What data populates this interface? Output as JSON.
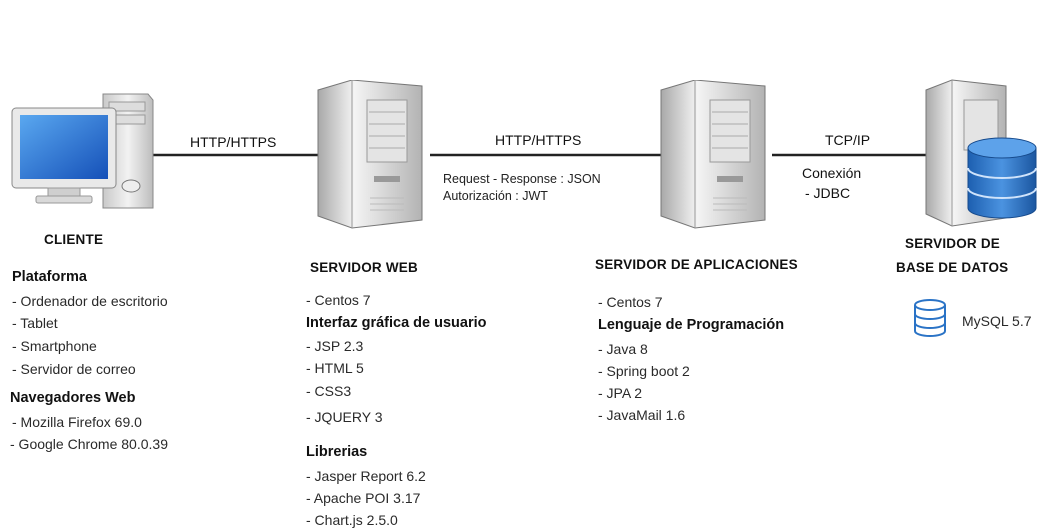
{
  "connections": {
    "client_web": {
      "protocol": "HTTP/HTTPS"
    },
    "web_app": {
      "protocol": "HTTP/HTTPS",
      "details": [
        "Request - Response : JSON",
        "Autorización : JWT"
      ]
    },
    "app_db": {
      "protocol": "TCP/IP",
      "details": [
        "Conexión",
        "- JDBC"
      ]
    }
  },
  "client": {
    "title": "CLIENTE",
    "platform_heading": "Plataforma",
    "platforms": [
      "- Ordenador de escritorio",
      "- Tablet",
      "- Smartphone",
      "- Servidor de correo"
    ],
    "browsers_heading": "Navegadores Web",
    "browsers": [
      "-  Mozilla Firefox 69.0",
      "-  Google Chrome  80.0.39"
    ]
  },
  "web_server": {
    "title": "SERVIDOR WEB",
    "os": "- Centos 7",
    "gui_heading": "Interfaz gráfica de usuario",
    "gui_items": [
      "- JSP 2.3",
      "- HTML 5",
      "- CSS3",
      "- JQUERY 3"
    ],
    "libs_heading": "Librerias",
    "libs": [
      "- Jasper Report 6.2",
      "- Apache POI 3.17",
      "- Chart.js 2.5.0"
    ]
  },
  "app_server": {
    "title": "SERVIDOR DE APLICACIONES",
    "os": "- Centos 7",
    "lang_heading": "Lenguaje de Programación",
    "lang_items": [
      "- Java 8",
      "- Spring boot 2",
      "- JPA 2",
      "- JavaMail 1.6"
    ]
  },
  "db_server": {
    "title_line1": "SERVIDOR DE",
    "title_line2": "BASE DE DATOS",
    "db": "MySQL 5.7"
  },
  "colors": {
    "line": "#222222",
    "screen": "#1f6fd6",
    "tower": "#dadada",
    "db_blue": "#2a73c6"
  }
}
